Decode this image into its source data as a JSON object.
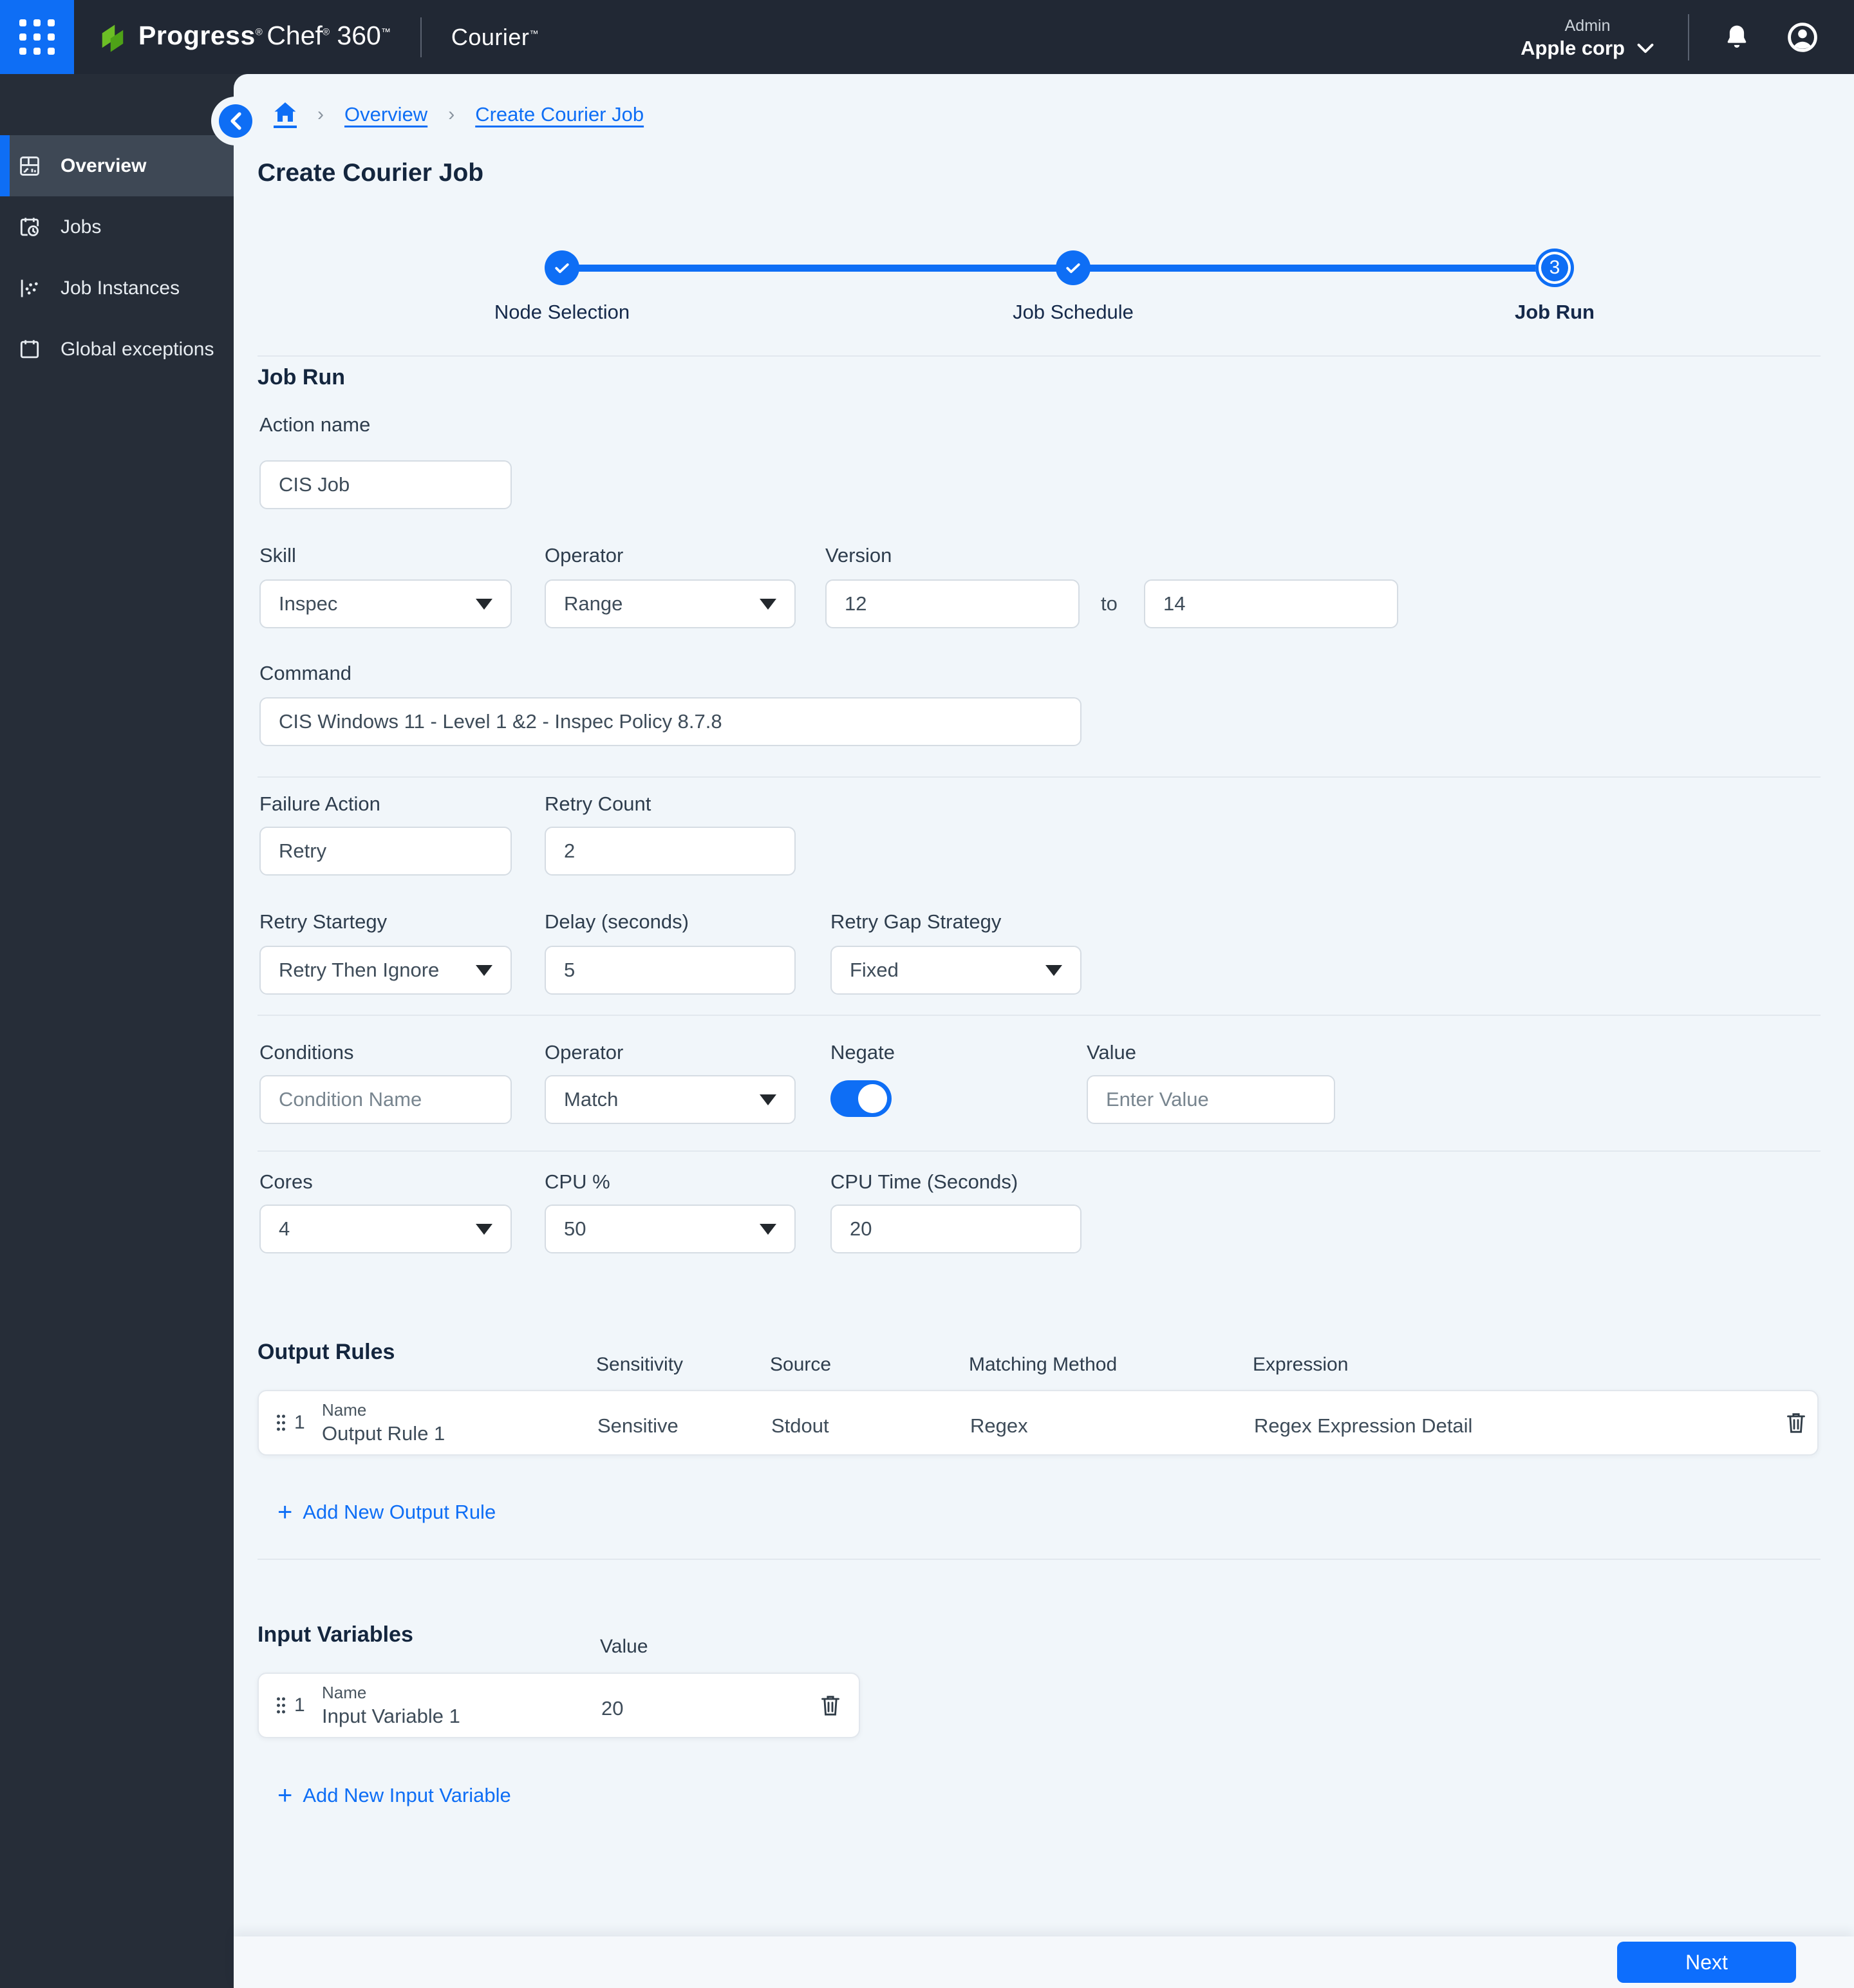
{
  "colors": {
    "accent": "#0E6EF5",
    "navy": "#14263E",
    "header_bg": "#212834",
    "sidebar_bg": "#262D38",
    "content_bg": "#F1F6FA"
  },
  "header": {
    "brand": {
      "part1": "Progress",
      "reg1": "®",
      "part2": "Chef",
      "reg2": "®",
      "part3": "360",
      "mark": "™"
    },
    "product": "Courier",
    "product_mark": "™",
    "role": "Admin",
    "org": "Apple corp"
  },
  "sidebar": {
    "items": [
      {
        "label": "Overview",
        "active": true
      },
      {
        "label": "Jobs",
        "active": false
      },
      {
        "label": "Job Instances",
        "active": false
      },
      {
        "label": "Global exceptions",
        "active": false
      }
    ]
  },
  "breadcrumb": {
    "items": [
      "Overview",
      "Create Courier Job"
    ],
    "separator": "›"
  },
  "page": {
    "title": "Create Courier Job"
  },
  "stepper": {
    "steps": [
      {
        "label": "Node Selection",
        "state": "done"
      },
      {
        "label": "Job Schedule",
        "state": "done"
      },
      {
        "label": "Job Run",
        "state": "current",
        "number": "3"
      }
    ]
  },
  "form": {
    "section_title": "Job Run",
    "action_name": {
      "label": "Action name",
      "value": "CIS Job"
    },
    "skill": {
      "label": "Skill",
      "value": "Inspec"
    },
    "operator": {
      "label": "Operator",
      "value": "Range"
    },
    "version": {
      "label": "Version",
      "from": "12",
      "to_word": "to",
      "to": "14"
    },
    "command": {
      "label": "Command",
      "value": "CIS Windows 11 - Level 1 &2 - Inspec Policy 8.7.8"
    },
    "failure_action": {
      "label": "Failure Action",
      "value": "Retry"
    },
    "retry_count": {
      "label": "Retry Count",
      "value": "2"
    },
    "retry_strategy": {
      "label": "Retry Startegy",
      "value": "Retry Then Ignore"
    },
    "delay": {
      "label": "Delay (seconds)",
      "value": "5"
    },
    "retry_gap": {
      "label": "Retry Gap Strategy",
      "value": "Fixed"
    },
    "conditions": {
      "label": "Conditions",
      "placeholder": "Condition Name"
    },
    "cond_operator": {
      "label": "Operator",
      "value": "Match"
    },
    "negate": {
      "label": "Negate",
      "on": true
    },
    "cond_value": {
      "label": "Value",
      "placeholder": "Enter Value"
    },
    "cores": {
      "label": "Cores",
      "value": "4"
    },
    "cpu_pct": {
      "label": "CPU %",
      "value": "50"
    },
    "cpu_time": {
      "label": "CPU Time (Seconds)",
      "value": "20"
    }
  },
  "output_rules": {
    "title": "Output Rules",
    "name_label": "Name",
    "columns": [
      "Sensitivity",
      "Source",
      "Matching Method",
      "Expression"
    ],
    "rows": [
      {
        "index": "1",
        "name": "Output Rule 1",
        "sensitivity": "Sensitive",
        "source": "Stdout",
        "matching_method": "Regex",
        "expression": "Regex Expression Detail"
      }
    ],
    "add_plus": "+",
    "add_label": "Add New Output Rule"
  },
  "input_variables": {
    "title": "Input Variables",
    "value_column": "Value",
    "name_label": "Name",
    "rows": [
      {
        "index": "1",
        "name": "Input Variable 1",
        "value": "20"
      }
    ],
    "add_plus": "+",
    "add_label": "Add New Input Variable"
  },
  "footer": {
    "next_label": "Next"
  }
}
